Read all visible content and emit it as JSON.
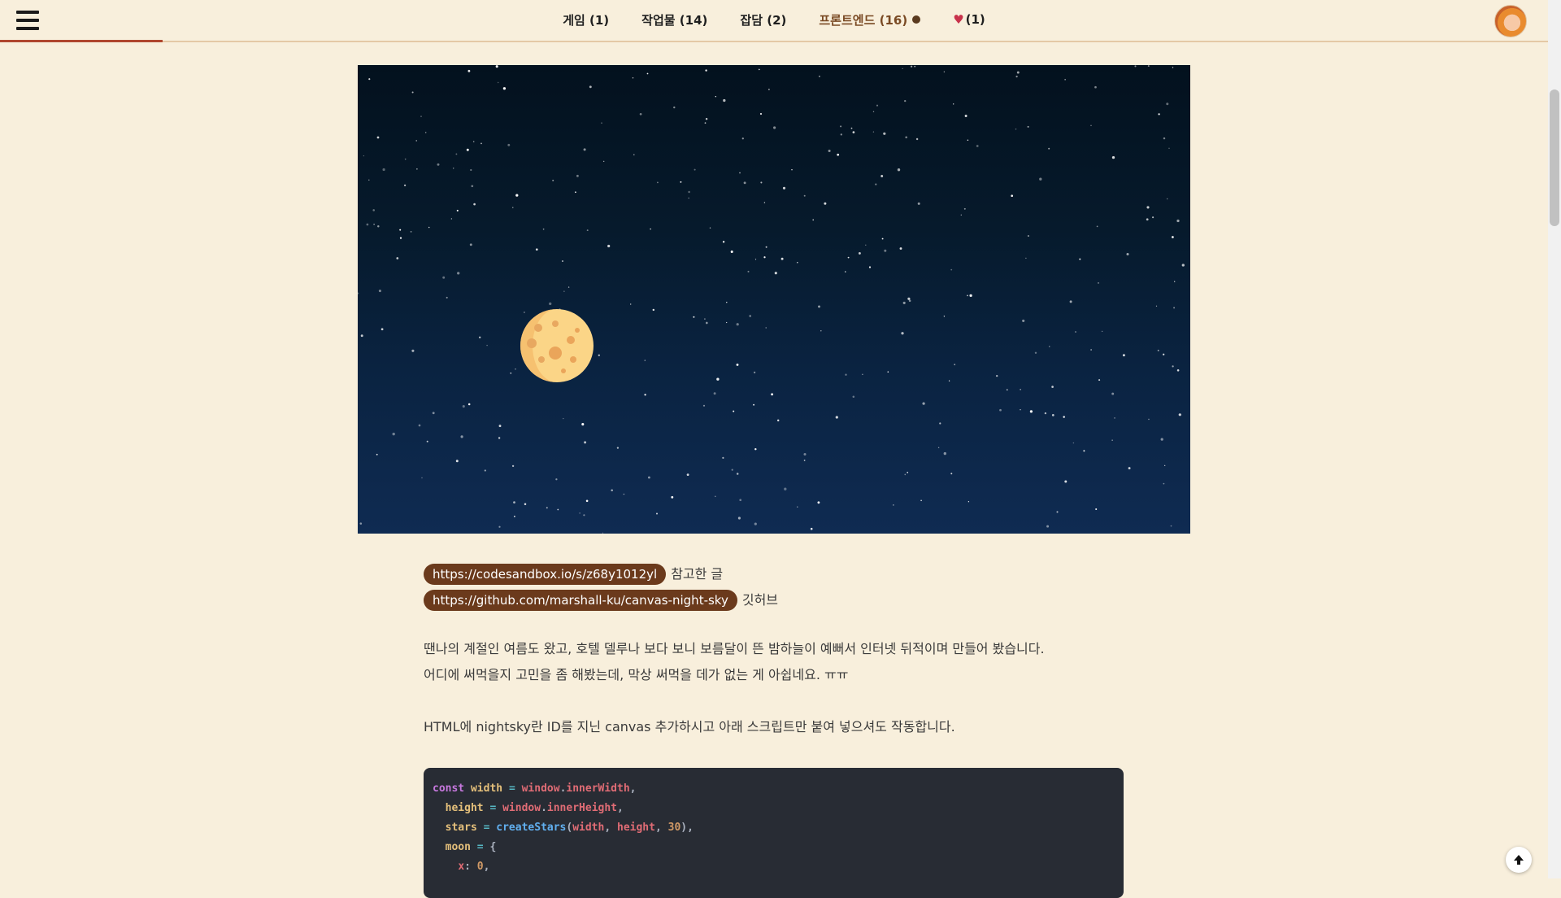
{
  "nav": {
    "items": [
      {
        "label": "게임 (1)"
      },
      {
        "label": "작업물 (14)"
      },
      {
        "label": "잡담 (2)"
      },
      {
        "label": "프론트엔드 (16)"
      },
      {
        "label": "(1)"
      }
    ],
    "active_index": 3,
    "menu_icon": "hamburger-menu-icon",
    "favorites_icon": "heart-icon",
    "avatar_icon": "profile-avatar"
  },
  "reading_progress": 0.105,
  "post": {
    "links": [
      {
        "url": "https://codesandbox.io/s/z68y1012yl",
        "caption": "참고한 글"
      },
      {
        "url": "https://github.com/marshall-ku/canvas-night-sky",
        "caption": "깃허브"
      }
    ],
    "paragraph1": [
      "땐나의 계절인 여름도 왔고, 호텔 델루나 보다 보니 보름달이 뜬 밤하늘이 예뻐서 인터넷 뒤적이며 만들어 봤습니다.",
      "어디에 써먹을지 고민을 좀 해봤는데, 막상 써먹을 데가 없는 게 아쉽네요. ㅠㅠ"
    ],
    "paragraph2": "HTML에 nightsky란 ID를 지닌 canvas 추가하시고 아래 스크립트만 붙여 넣으셔도 작동합니다.",
    "code": {
      "line1": {
        "kw": "const",
        "name": "width",
        "eq": "=",
        "obj": "window",
        "prop": "innerWidth"
      },
      "line2": {
        "name": "height",
        "eq": "=",
        "obj": "window",
        "prop": "innerHeight"
      },
      "line3": {
        "name": "stars",
        "eq": "=",
        "fn": "createStars",
        "arg1": "width",
        "arg2": "height",
        "arg3": "30"
      },
      "line4": {
        "name": "moon",
        "eq": "=",
        "brace": "{"
      },
      "line5": {
        "key": "x",
        "val": "0"
      }
    }
  },
  "colors": {
    "background": "#f8efdc",
    "accent": "#6b3a1c",
    "progress": "#b0462e",
    "sky_top": "#03111e",
    "sky_bottom": "#0f2b52",
    "moon": "#fbd587",
    "code_bg": "#282c34"
  },
  "scroll_to_top_icon": "arrow-up-icon"
}
